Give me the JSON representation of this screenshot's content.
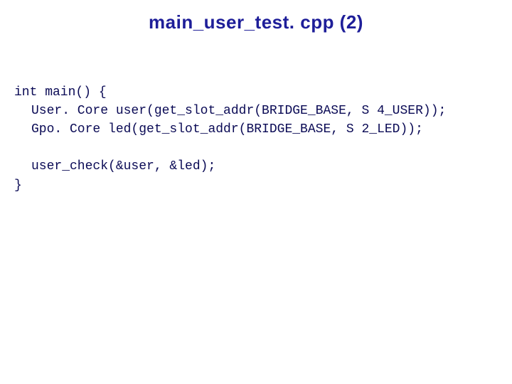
{
  "title": "main_user_test. cpp (2)",
  "code": {
    "line1": "int main() {",
    "line2": "User. Core user(get_slot_addr(BRIDGE_BASE, S 4_USER));",
    "line3": "Gpo. Core led(get_slot_addr(BRIDGE_BASE, S 2_LED));",
    "line4": "",
    "line5": "user_check(&user, &led);",
    "line6": "}"
  }
}
